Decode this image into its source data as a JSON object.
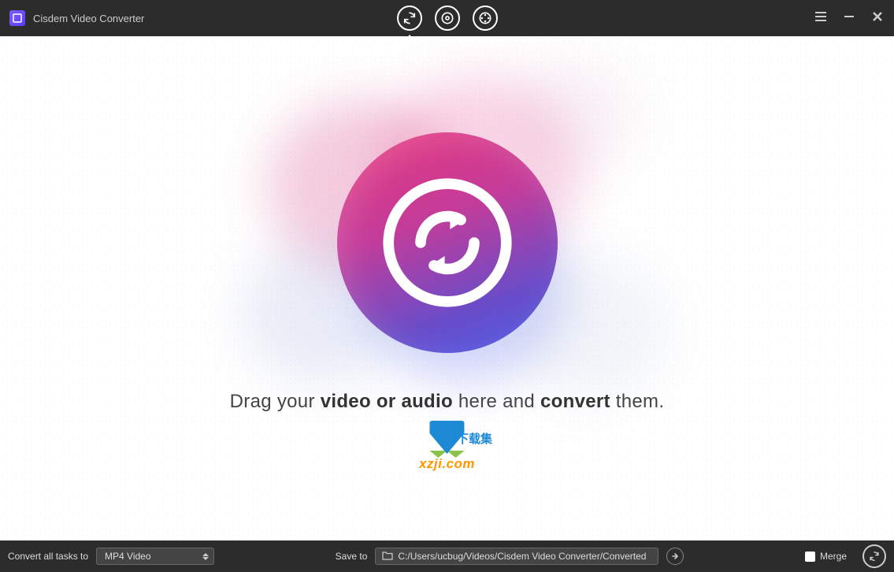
{
  "app": {
    "title": "Cisdem Video Converter"
  },
  "modes": {
    "convert_name": "convert-mode",
    "download_name": "download-mode",
    "rip_name": "rip-mode"
  },
  "main": {
    "instruction_plain1": "Drag your ",
    "instruction_bold1": "video or audio",
    "instruction_plain2": " here and ",
    "instruction_bold2": "convert",
    "instruction_plain3": " them."
  },
  "watermark": {
    "cn_text": "下载集",
    "url_text": "xzji.com"
  },
  "bottom": {
    "convert_all_label": "Convert all tasks to",
    "format_value": "MP4 Video",
    "save_to_label": "Save to",
    "save_path": "C:/Users/ucbug/Videos/Cisdem Video Converter/Converted",
    "merge_label": "Merge"
  }
}
